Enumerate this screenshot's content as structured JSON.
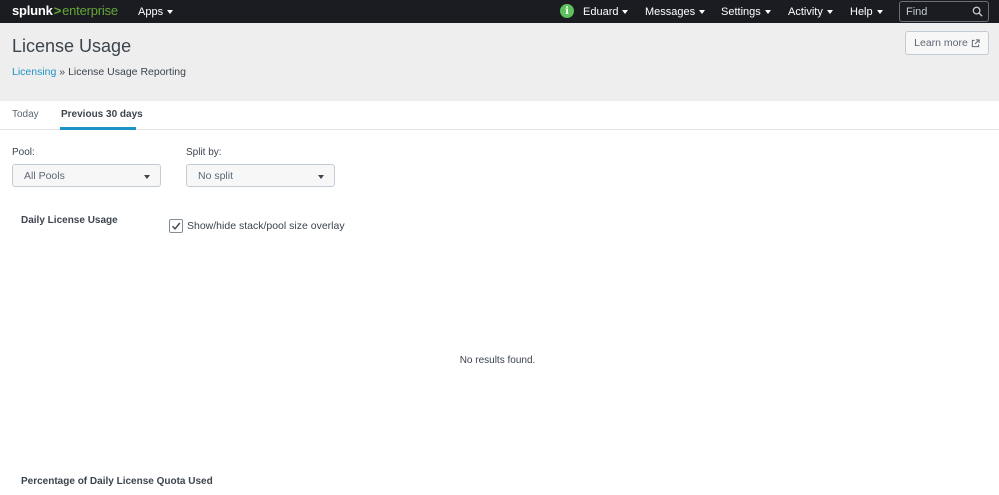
{
  "topbar": {
    "logo_main": "splunk",
    "logo_sep": ">",
    "logo_product": "enterprise",
    "apps": "Apps",
    "user": "Eduard",
    "messages": "Messages",
    "settings": "Settings",
    "activity": "Activity",
    "help": "Help",
    "find_placeholder": "Find",
    "status_color": "#5cc05c"
  },
  "header": {
    "title": "License Usage",
    "breadcrumb_link": "Licensing",
    "breadcrumb_sep": " » ",
    "breadcrumb_current": "License Usage Reporting",
    "learn_more": "Learn more"
  },
  "tabs": [
    {
      "label": "Today",
      "active": false
    },
    {
      "label": "Previous 30 days",
      "active": true
    }
  ],
  "filters": {
    "pool_label": "Pool:",
    "pool_value": "All Pools",
    "split_label": "Split by:",
    "split_value": "No split"
  },
  "daily_usage": {
    "title": "Daily License Usage",
    "overlay_label": "Show/hide stack/pool size overlay",
    "overlay_checked": true,
    "empty_message": "No results found."
  },
  "quota": {
    "title": "Percentage of Daily License Quota Used"
  },
  "colors": {
    "accent": "#1e93c6",
    "brand_green": "#65a637",
    "nav_bg": "#1a1c21"
  }
}
